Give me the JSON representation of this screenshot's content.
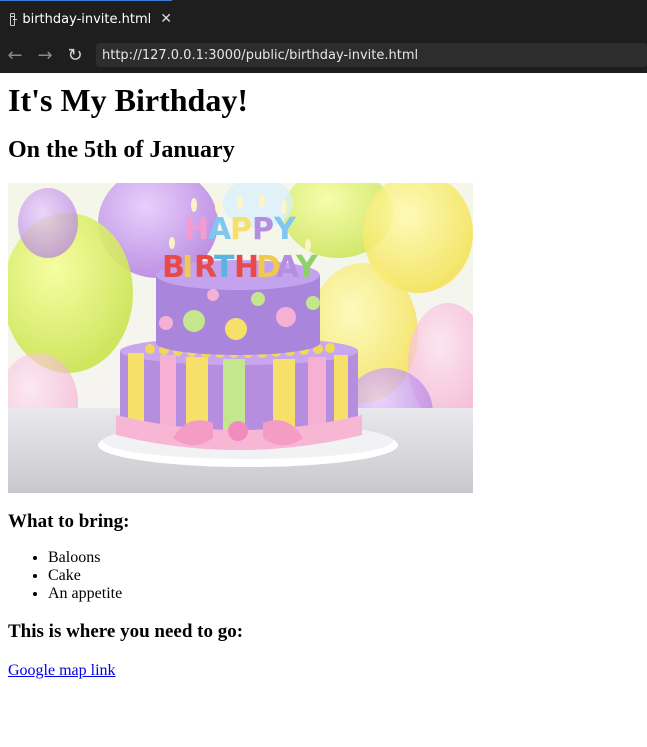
{
  "browser": {
    "tab_title": "birthday-invite.html",
    "close_glyph": "✕",
    "back_glyph": "←",
    "forward_glyph": "→",
    "reload_glyph": "↻",
    "url": "http://127.0.0.1:3000/public/birthday-invite.html"
  },
  "page": {
    "heading": "It's My Birthday!",
    "subheading": "On the 5th of January",
    "image_icon": "birthday-cake-image",
    "bring_heading": "What to bring:",
    "bring_items": [
      "Baloons",
      "Cake",
      "An appetite"
    ],
    "where_heading": "This is where you need to go:",
    "map_link": "Google map link"
  },
  "colors": {
    "link": "#0000ee",
    "chrome_bg": "#1e1e1e",
    "tab_accent": "#3c7bd9"
  }
}
